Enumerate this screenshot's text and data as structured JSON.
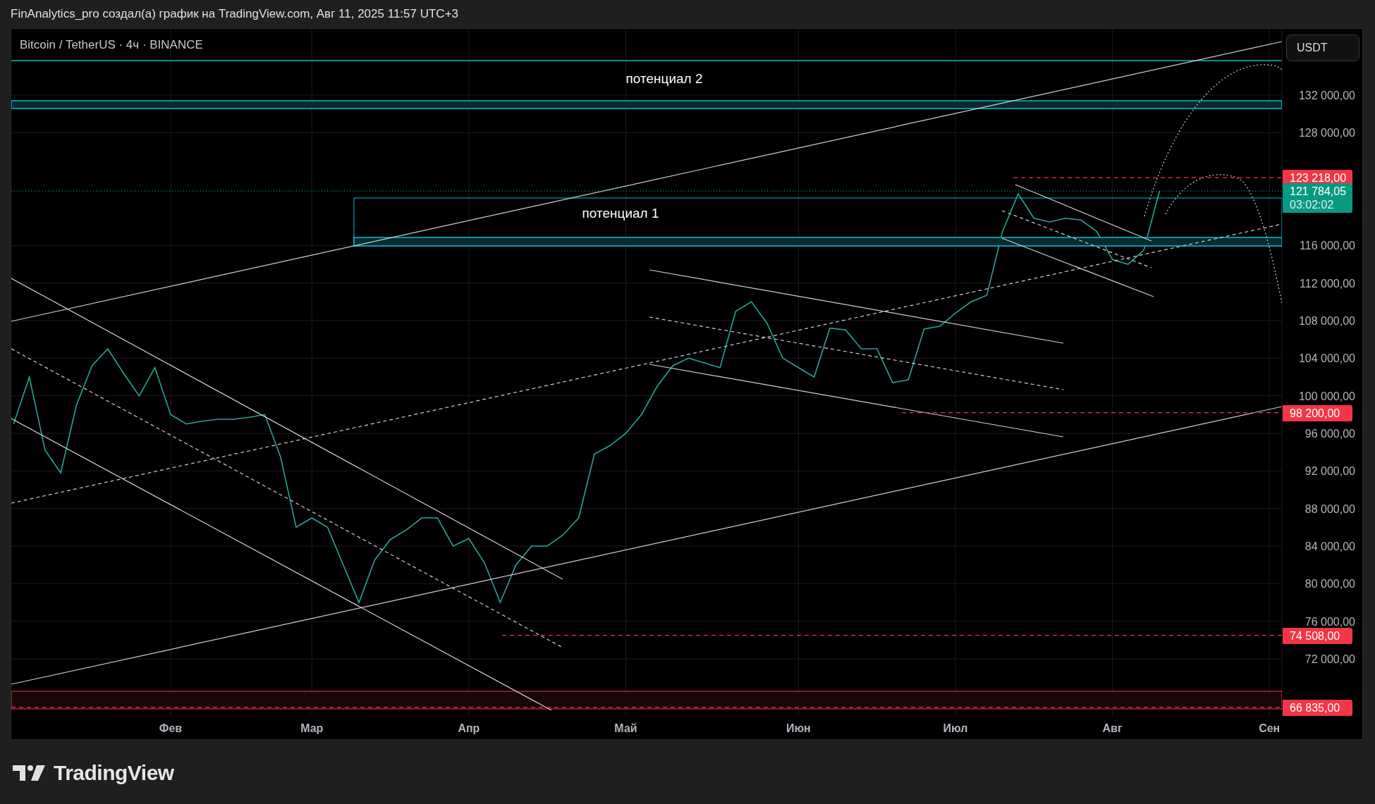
{
  "header": {
    "caption": "FinAnalytics_pro создал(а) график на TradingView.com, Авг 11, 2025 11:57 UTC+3"
  },
  "chart": {
    "symbol": "Bitcoin / TetherUS · 4ч · BINANCE",
    "currency": "USDT",
    "zone_labels": [
      {
        "text": "потенциал 2",
        "kind": "upper"
      },
      {
        "text": "потенциал 1",
        "kind": "lower"
      }
    ],
    "price_markers": [
      {
        "text": "123 218,00",
        "color": "#f23645",
        "kind": "level"
      },
      {
        "text": "121 784,05",
        "countdown": "03:02:02",
        "color": "#089981",
        "kind": "last"
      },
      {
        "text": "98 200,00",
        "color": "#f23645",
        "kind": "level"
      },
      {
        "text": "74 508,00",
        "color": "#f23645",
        "kind": "level"
      },
      {
        "text": "66 835,00",
        "color": "#f23645",
        "kind": "level"
      }
    ],
    "chart_data": {
      "type": "line",
      "grid": true,
      "ylim": [
        65925,
        139050
      ],
      "categories": [
        null,
        null,
        null,
        null,
        null,
        null,
        null,
        null,
        null,
        null,
        "Фев",
        null,
        null,
        null,
        null,
        null,
        null,
        null,
        null,
        "Мар",
        null,
        null,
        null,
        null,
        null,
        null,
        null,
        null,
        null,
        "Апр",
        null,
        null,
        null,
        null,
        null,
        null,
        null,
        null,
        null,
        "Май",
        null,
        null,
        null,
        null,
        null,
        null,
        null,
        null,
        null,
        null,
        "Июн",
        null,
        null,
        null,
        null,
        null,
        null,
        null,
        null,
        null,
        "Июл",
        null,
        null,
        null,
        null,
        null,
        null,
        null,
        null,
        null,
        "Авг",
        null,
        null,
        null,
        null,
        null,
        null,
        null,
        null,
        null,
        "Сен"
      ],
      "series": [
        {
          "color": "#26a69a",
          "values": [
            97000,
            102000,
            94200,
            91800,
            99000,
            103200,
            105000,
            102400,
            100000,
            103000,
            98000,
            97000,
            97300,
            97500,
            97500,
            97700,
            98000,
            93500,
            86000,
            87000,
            86000,
            82000,
            78000,
            82500,
            84700,
            85700,
            87000,
            87000,
            84000,
            84800,
            82200,
            78000,
            82000,
            84000,
            84000,
            85200,
            87000,
            93800,
            94700,
            96000,
            98000,
            101000,
            103200,
            104000,
            103500,
            103000,
            109000,
            110000,
            107700,
            104000,
            103000,
            102000,
            107200,
            107000,
            105000,
            105000,
            101400,
            101700,
            107100,
            107400,
            108800,
            110000,
            110700,
            117500,
            121500,
            118900,
            118500,
            118900,
            118700,
            117500,
            114500,
            114000,
            115500,
            121800,
            null,
            null,
            null,
            null,
            null,
            null,
            null
          ]
        }
      ],
      "yticks": [
        {
          "value": 132000,
          "label": "132 000,00"
        },
        {
          "value": 128000,
          "label": "128 000,00"
        },
        {
          "value": 116000,
          "label": "116 000,00"
        },
        {
          "value": 112000,
          "label": "112 000,00"
        },
        {
          "value": 108000,
          "label": "108 000,00"
        },
        {
          "value": 104000,
          "label": "104 000,00"
        },
        {
          "value": 100000,
          "label": "100 000,00"
        },
        {
          "value": 96000,
          "label": "96 000,00"
        },
        {
          "value": 92000,
          "label": "92 000,00"
        },
        {
          "value": 88000,
          "label": "88 000,00"
        },
        {
          "value": 84000,
          "label": "84 000,00"
        },
        {
          "value": 80000,
          "label": "80 000,00"
        },
        {
          "value": 76000,
          "label": "76 000,00"
        },
        {
          "value": 72000,
          "label": "72 000,00"
        }
      ]
    }
  },
  "footer": {
    "logo_text": "TradingView"
  }
}
